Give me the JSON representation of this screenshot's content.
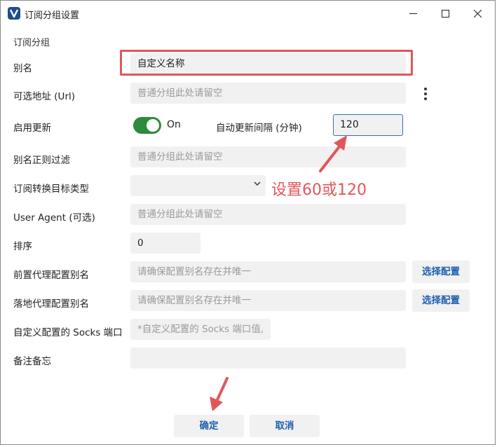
{
  "window": {
    "title": "订阅分组设置",
    "controls": [
      "minimize-icon",
      "maximize-icon",
      "close-icon"
    ]
  },
  "form": {
    "group_caption": "订阅分组",
    "alias": {
      "label": "别名",
      "value": "自定义名称"
    },
    "url": {
      "label": "可选地址 (Url)",
      "placeholder": "普通分组此处请留空"
    },
    "enable_update": {
      "label": "启用更新",
      "state": "On"
    },
    "interval": {
      "label": "自动更新间隔 (分钟)",
      "value": "120"
    },
    "alias_filter": {
      "label": "别名正则过滤",
      "placeholder": "普通分组此处请留空"
    },
    "convert_target": {
      "label": "订阅转换目标类型",
      "selected": ""
    },
    "user_agent": {
      "label": "User Agent (可选)",
      "placeholder": "普通分组此处请留空"
    },
    "sort": {
      "label": "排序",
      "value": "0"
    },
    "prev_proxy": {
      "label": "前置代理配置别名",
      "placeholder": "请确保配置别名存在并唯一",
      "button": "选择配置"
    },
    "next_proxy": {
      "label": "落地代理配置别名",
      "placeholder": "请确保配置别名存在并唯一",
      "button": "选择配置"
    },
    "socks_port": {
      "label": "自定义配置的 Socks 端口",
      "placeholder": "*自定义配置的 Socks 端口值,"
    },
    "memo": {
      "label": "备注备忘",
      "value": ""
    }
  },
  "annotation": {
    "text": "设置60或120",
    "color": "#e2565a"
  },
  "footer": {
    "ok_label": "确定",
    "cancel_label": "取消"
  },
  "colors": {
    "accent": "#1e5fb0",
    "toggle_on": "#2e8b3e",
    "highlight": "#e2565a"
  }
}
